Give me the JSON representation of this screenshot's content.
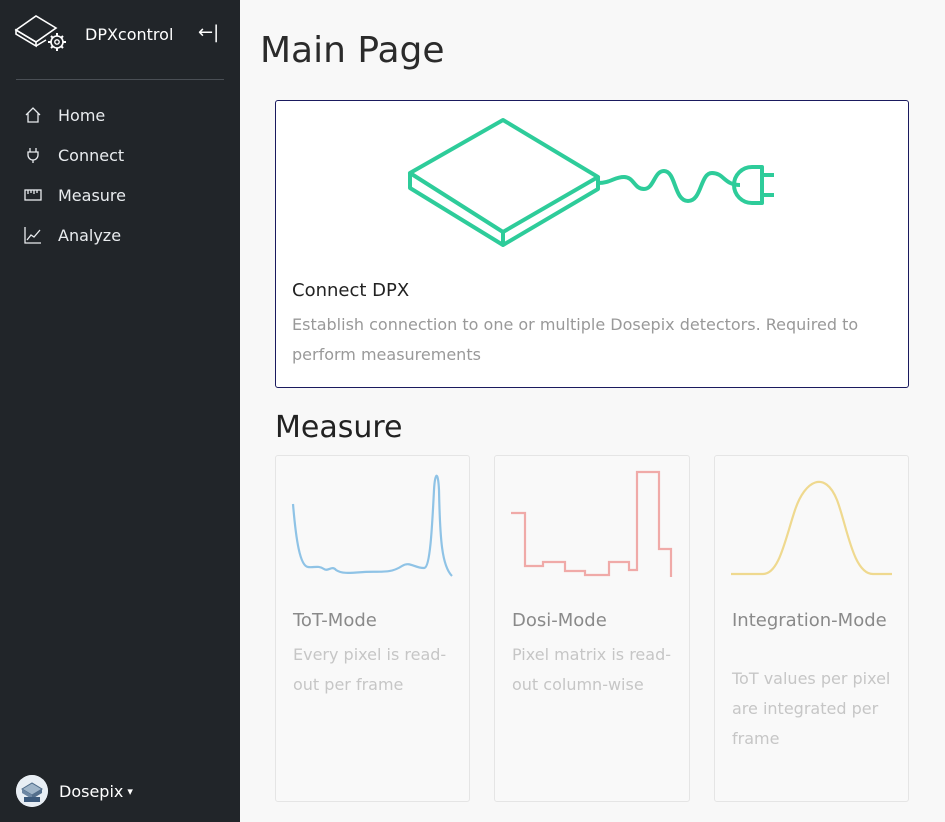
{
  "app": {
    "name": "DPXcontrol",
    "collapse_glyph": "←|"
  },
  "sidebar": {
    "items": [
      {
        "label": "Home",
        "icon": "home-icon"
      },
      {
        "label": "Connect",
        "icon": "plug-icon"
      },
      {
        "label": "Measure",
        "icon": "ruler-icon"
      },
      {
        "label": "Analyze",
        "icon": "chart-icon"
      }
    ],
    "user": {
      "name": "Dosepix",
      "caret": "▾"
    }
  },
  "main": {
    "title": "Main Page",
    "connect_card": {
      "title": "Connect DPX",
      "text": "Establish connection to one or multiple Dosepix detectors. Required to perform measurements",
      "accent": "#2ecc9a"
    },
    "measure_section": {
      "title": "Measure",
      "cards": [
        {
          "title": "ToT-Mode",
          "text": "Every pixel is read-out per frame",
          "color": "#8fc3e6"
        },
        {
          "title": "Dosi-Mode",
          "text": "Pixel matrix is read-out column-wise",
          "color": "#f0aaa8"
        },
        {
          "title": "Integration-Mode",
          "text": "ToT values per pixel are integrated per frame",
          "color": "#efd98f"
        }
      ]
    }
  },
  "colors": {
    "sidebar_bg": "#212529",
    "border": "#1a1a5e"
  }
}
